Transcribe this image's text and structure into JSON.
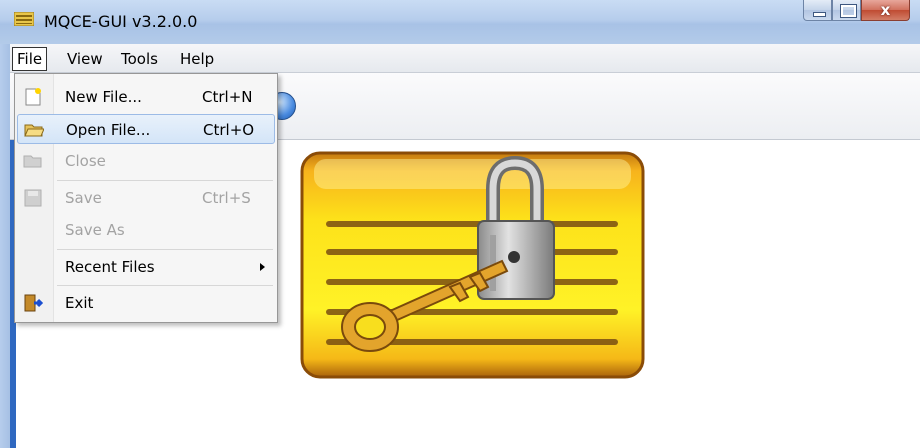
{
  "window": {
    "title": "MQCE-GUI v3.2.0.0",
    "close_glyph": "x"
  },
  "menubar": {
    "items": [
      {
        "label": "File",
        "active": true
      },
      {
        "label": "View"
      },
      {
        "label": "Tools"
      },
      {
        "label": "Help"
      }
    ]
  },
  "file_menu": {
    "items": [
      {
        "label": "New File...",
        "shortcut": "Ctrl+N",
        "icon": "new-file-icon",
        "enabled": true
      },
      {
        "label": "Open File...",
        "shortcut": "Ctrl+O",
        "icon": "open-folder-icon",
        "enabled": true,
        "highlighted": true
      },
      {
        "label": "Close",
        "shortcut": "",
        "icon": "close-folder-icon",
        "enabled": false
      },
      {
        "label": "Save",
        "shortcut": "Ctrl+S",
        "icon": "save-disk-icon",
        "enabled": false
      },
      {
        "label": "Save As",
        "shortcut": "",
        "enabled": true
      },
      {
        "label": "Recent Files",
        "submenu": true,
        "enabled": true
      },
      {
        "label": "Exit",
        "icon": "exit-door-icon",
        "enabled": true
      }
    ]
  },
  "main": {
    "image": "padlock-and-key-logo"
  },
  "colors": {
    "titlebar": "#b6cdec",
    "highlight": "#d4e5f8",
    "logo_gold": "#f5d000"
  }
}
